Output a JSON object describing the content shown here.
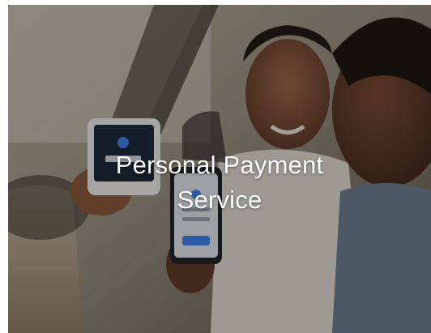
{
  "card": {
    "title_line1": "Personal Payment",
    "title_line2": "Service",
    "image_semantic": "photo of two men in a car using a handheld card payment terminal and a smartphone"
  },
  "colors": {
    "overlay": "#14100c",
    "caption_text": "#ffffff"
  }
}
